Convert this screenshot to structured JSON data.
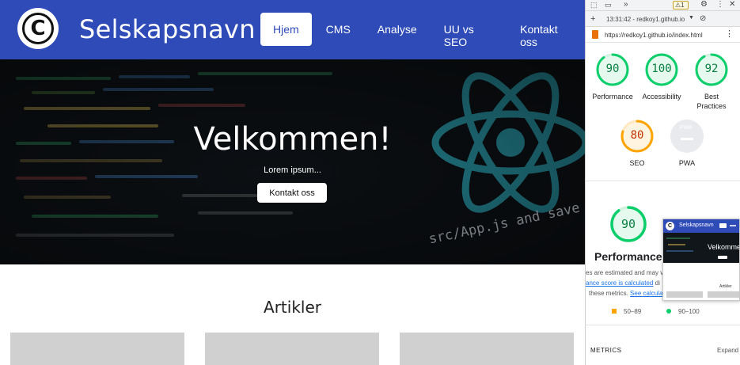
{
  "site": {
    "brand": "Selskapsnavn",
    "logo_letter": "C",
    "nav": [
      {
        "label": "Hjem",
        "active": true
      },
      {
        "label": "CMS",
        "active": false
      },
      {
        "label": "Analyse",
        "active": false
      },
      {
        "label": "UU vs SEO",
        "active": false
      },
      {
        "label": "Kontakt oss",
        "active": false
      }
    ],
    "hero": {
      "title": "Velkommen!",
      "subtitle": "Lorem ipsum...",
      "button": "Kontakt oss",
      "background_text": "src/App.js and save to rel"
    },
    "articles_title": "Artikler"
  },
  "devtools": {
    "time": "13:31:42 - redkoy1.github.io",
    "url": "https://redkoy1.github.io/index.html",
    "warning_count": "1",
    "scores": [
      {
        "label": "Performance",
        "value": "90",
        "fraction": 0.9,
        "color": "#0cce6b"
      },
      {
        "label": "Accessibility",
        "value": "100",
        "fraction": 1.0,
        "color": "#0cce6b"
      },
      {
        "label": "Best\nPractices",
        "value": "92",
        "fraction": 0.92,
        "color": "#0cce6b"
      },
      {
        "label": "SEO",
        "value": "80",
        "fraction": 0.8,
        "color": "#ffa400"
      },
      {
        "label": "PWA",
        "value": "PWA",
        "fraction": 0,
        "color": "#9aa0a6"
      }
    ],
    "performance_title": "Performance",
    "performance_score": "90",
    "note_line1": "es are estimated and may va",
    "note_link": "ance score is calculated",
    "note_line2_tail": " di",
    "note_line3": "these metrics.",
    "note_link2": "See calcula",
    "legend_mid": "50–89",
    "legend_high": "90–100",
    "metrics_label": "METRICS",
    "expand_label": "Expand",
    "thumb_brand": "Selskapsnavn",
    "thumb_hero": "Velkomme",
    "thumb_articles": "Artikler"
  }
}
